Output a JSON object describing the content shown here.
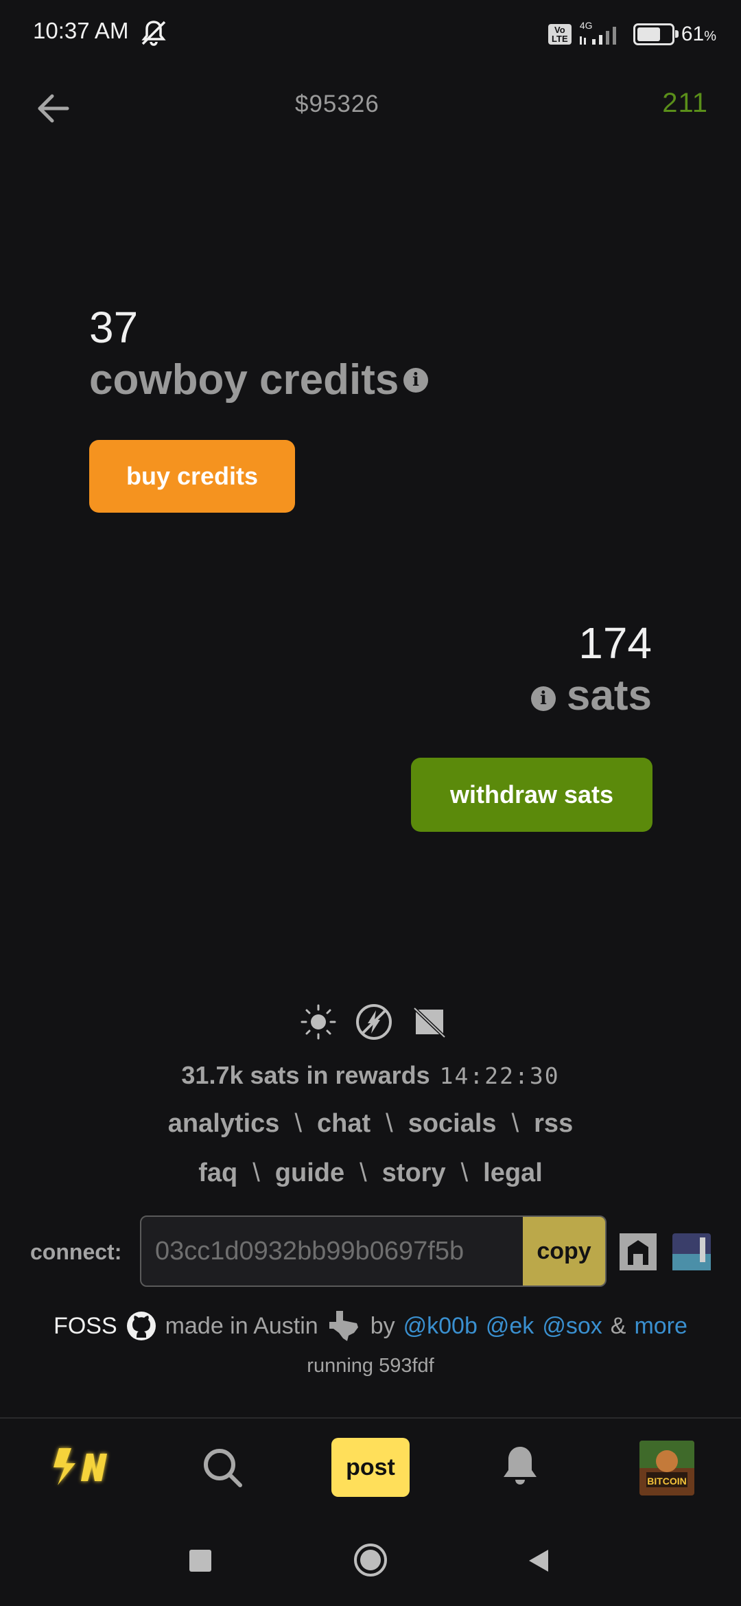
{
  "status_bar": {
    "time": "10:37 AM",
    "network": "4G",
    "volte": "Vo LTE",
    "battery_percent": "61",
    "battery_symbol": "%"
  },
  "header": {
    "price": "$95326",
    "count": "211"
  },
  "credits": {
    "amount": "37",
    "label": "cowboy credits",
    "info": "i",
    "button": "buy credits"
  },
  "sats": {
    "amount": "174",
    "label": "sats",
    "info": "i",
    "button": "withdraw sats"
  },
  "footer": {
    "rewards": "31.7k sats in rewards",
    "rewards_timer": "14:22:30",
    "links_row1": [
      "analytics",
      "chat",
      "socials",
      "rss"
    ],
    "links_row2": [
      "faq",
      "guide",
      "story",
      "legal"
    ],
    "separator": "\\",
    "connect_label": "connect:",
    "connect_value": "03cc1d0932bb99b0697f5b",
    "copy_label": "copy",
    "foss": "FOSS",
    "made_in": "made in Austin",
    "by": "by",
    "authors": [
      "@k00b",
      "@ek",
      "@sox"
    ],
    "amp": "&",
    "more": "more",
    "running": "running 593fdf"
  },
  "bottom_nav": {
    "post_label": "post",
    "avatar_text": "BITCOIN"
  },
  "colors": {
    "background": "#121214",
    "buy_orange": "#f5931f",
    "withdraw_green": "#5b8a0b",
    "post_yellow": "#ffdf5a",
    "copy_gold": "#bba84a",
    "link_blue": "#3a90d0",
    "count_green": "#5a8f1a"
  },
  "icons": {
    "bell_muted": "bell-slash-icon",
    "back": "arrow-left-icon",
    "theme": "sun-icon",
    "lightning_off": "lightning-off-icon",
    "image_off": "image-off-icon",
    "github": "github-icon",
    "texas": "texas-icon",
    "search": "search-icon",
    "notifications": "bell-icon"
  }
}
